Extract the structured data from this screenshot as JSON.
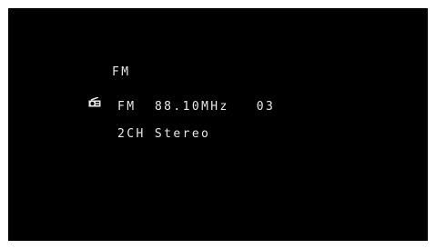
{
  "source": {
    "icon": "radio-icon",
    "label": "FM"
  },
  "tuner": {
    "band": "FM",
    "frequency": "88.10MHz",
    "preset": "03"
  },
  "audio": {
    "mode": "2CH Stereo"
  },
  "colors": {
    "background": "#000000",
    "text": "#e8e8e8",
    "border": "#ffffff"
  }
}
